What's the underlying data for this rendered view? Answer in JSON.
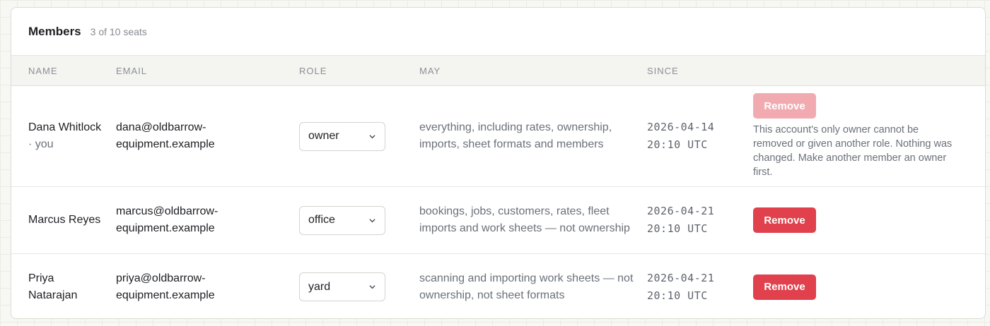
{
  "header": {
    "title": "Members",
    "seats": "3 of 10 seats"
  },
  "columns": {
    "name": "NAME",
    "email": "EMAIL",
    "role": "ROLE",
    "may": "MAY",
    "since": "SINCE"
  },
  "members": [
    {
      "name": "Dana Whitlock",
      "you_suffix": "· you",
      "email": "dana@oldbarrow-equipment.example",
      "role": "owner",
      "may": "everything, including rates, ownership, imports, sheet formats and members",
      "since": "2026-04-14 20:10 UTC",
      "remove_label": "Remove",
      "remove_disabled": true,
      "note": "This account's only owner cannot be removed or given another role. Nothing was changed. Make another member an owner first."
    },
    {
      "name": "Marcus Reyes",
      "email": "marcus@oldbarrow-equipment.example",
      "role": "office",
      "may": "bookings, jobs, customers, rates, fleet imports and work sheets — not ownership",
      "since": "2026-04-21 20:10 UTC",
      "remove_label": "Remove",
      "remove_disabled": false
    },
    {
      "name": "Priya Natarajan",
      "email": "priya@oldbarrow-equipment.example",
      "role": "yard",
      "may": "scanning and importing work sheets — not ownership, not sheet formats",
      "since": "2026-04-21 20:10 UTC",
      "remove_label": "Remove",
      "remove_disabled": false
    }
  ],
  "icons": {
    "select_chevron": "chevron-down-icon"
  },
  "colors": {
    "danger": "#e0414d",
    "danger_disabled": "#f2aab1"
  }
}
